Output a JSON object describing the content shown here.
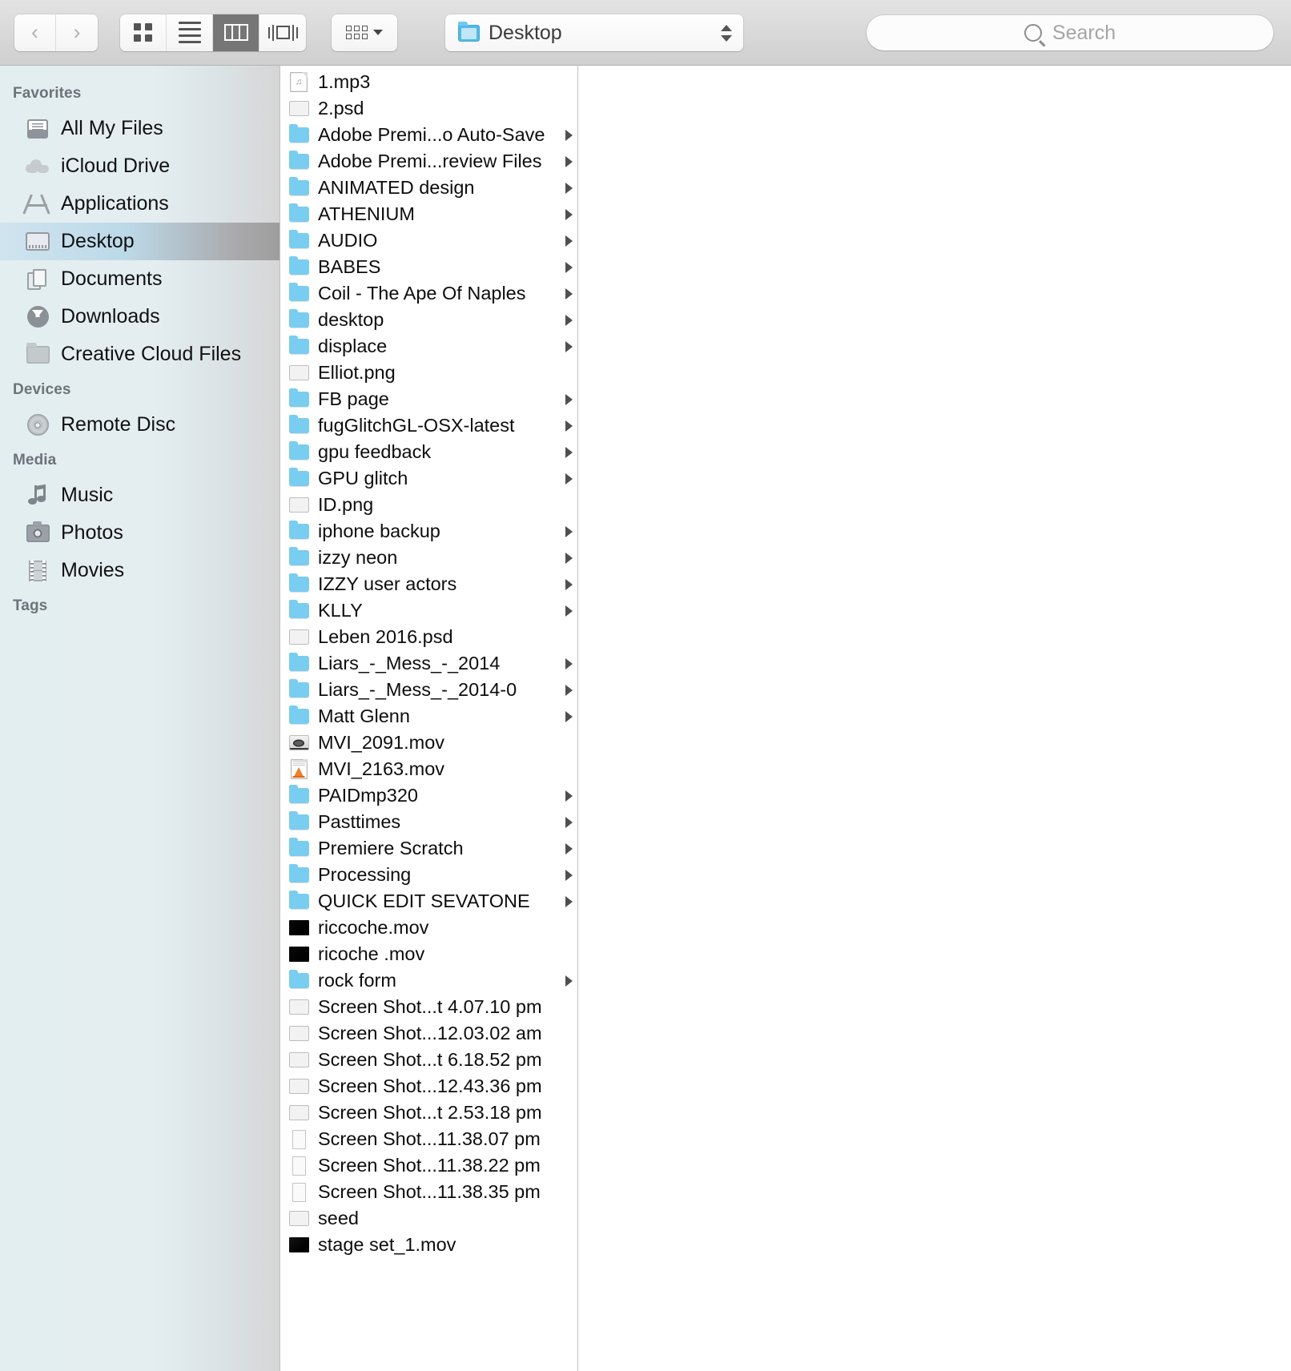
{
  "toolbar": {
    "back_icon": "chevron-left-icon",
    "forward_icon": "chevron-right-icon",
    "back_glyph": "‹",
    "forward_glyph": "›",
    "view_icon_grid": "icon-view-icon",
    "view_icon_list": "list-view-icon",
    "view_icon_column": "column-view-icon",
    "view_icon_coverflow": "coverflow-view-icon",
    "active_view": "column",
    "arrange_icon": "arrange-by-icon",
    "path_label": "Desktop",
    "path_icon": "blue-folder-icon",
    "stepper_icon": "up-down-stepper-icon",
    "search_placeholder": "Search",
    "search_value": "",
    "search_icon": "magnifier-icon"
  },
  "sidebar": {
    "sections": [
      {
        "title": "Favorites",
        "items": [
          {
            "label": "All My Files",
            "icon": "all-my-files-icon",
            "selected": false
          },
          {
            "label": "iCloud Drive",
            "icon": "icloud-drive-icon",
            "selected": false
          },
          {
            "label": "Applications",
            "icon": "applications-icon",
            "selected": false
          },
          {
            "label": "Desktop",
            "icon": "desktop-icon",
            "selected": true
          },
          {
            "label": "Documents",
            "icon": "documents-icon",
            "selected": false
          },
          {
            "label": "Downloads",
            "icon": "downloads-icon",
            "selected": false
          },
          {
            "label": "Creative Cloud Files",
            "icon": "creative-cloud-files-icon",
            "selected": false
          }
        ]
      },
      {
        "title": "Devices",
        "items": [
          {
            "label": "Remote Disc",
            "icon": "remote-disc-icon",
            "selected": false
          }
        ]
      },
      {
        "title": "Media",
        "items": [
          {
            "label": "Music",
            "icon": "music-icon",
            "selected": false
          },
          {
            "label": "Photos",
            "icon": "photos-icon",
            "selected": false
          },
          {
            "label": "Movies",
            "icon": "movies-icon",
            "selected": false
          }
        ]
      },
      {
        "title": "Tags",
        "items": []
      }
    ]
  },
  "file_column": {
    "path": "Desktop",
    "items": [
      {
        "name": "1.mp3",
        "icon": "audio-file-icon",
        "kind": "file",
        "expandable": false
      },
      {
        "name": "2.psd",
        "icon": "image-thumbnail-icon",
        "kind": "file",
        "expandable": false,
        "thumb": "#4a4a4a"
      },
      {
        "name": "Adobe Premi...o Auto-Save",
        "icon": "folder-icon",
        "kind": "folder",
        "expandable": true
      },
      {
        "name": "Adobe Premi...review Files",
        "icon": "folder-icon",
        "kind": "folder",
        "expandable": true
      },
      {
        "name": "ANIMATED design",
        "icon": "folder-icon",
        "kind": "folder",
        "expandable": true
      },
      {
        "name": "ATHENIUM",
        "icon": "folder-icon",
        "kind": "folder",
        "expandable": true
      },
      {
        "name": "AUDIO",
        "icon": "folder-icon",
        "kind": "folder",
        "expandable": true
      },
      {
        "name": "BABES",
        "icon": "folder-icon",
        "kind": "folder",
        "expandable": true
      },
      {
        "name": "Coil - The Ape Of Naples",
        "icon": "folder-icon",
        "kind": "folder",
        "expandable": true
      },
      {
        "name": "desktop",
        "icon": "folder-icon",
        "kind": "folder",
        "expandable": true
      },
      {
        "name": "displace",
        "icon": "folder-icon",
        "kind": "folder",
        "expandable": true
      },
      {
        "name": "Elliot.png",
        "icon": "image-thumbnail-icon",
        "kind": "file",
        "expandable": false,
        "thumb": "#3d3b3a"
      },
      {
        "name": "FB page",
        "icon": "folder-icon",
        "kind": "folder",
        "expandable": true
      },
      {
        "name": "fugGlitchGL-OSX-latest",
        "icon": "folder-icon",
        "kind": "folder",
        "expandable": true
      },
      {
        "name": "gpu feedback",
        "icon": "folder-icon",
        "kind": "folder",
        "expandable": true
      },
      {
        "name": "GPU glitch",
        "icon": "folder-icon",
        "kind": "folder",
        "expandable": true
      },
      {
        "name": "ID.png",
        "icon": "image-thumbnail-icon",
        "kind": "file",
        "expandable": false,
        "thumb": "#2b2b2b"
      },
      {
        "name": "iphone backup",
        "icon": "folder-icon",
        "kind": "folder",
        "expandable": true
      },
      {
        "name": "izzy neon",
        "icon": "folder-icon",
        "kind": "folder",
        "expandable": true
      },
      {
        "name": "IZZY user actors",
        "icon": "folder-icon",
        "kind": "folder",
        "expandable": true
      },
      {
        "name": "KLLY",
        "icon": "folder-icon",
        "kind": "folder",
        "expandable": true
      },
      {
        "name": "Leben 2016.psd",
        "icon": "image-thumbnail-icon",
        "kind": "file",
        "expandable": false,
        "thumb": "#1c1c1c"
      },
      {
        "name": "Liars_-_Mess_-_2014",
        "icon": "folder-icon",
        "kind": "folder",
        "expandable": true
      },
      {
        "name": "Liars_-_Mess_-_2014-0",
        "icon": "folder-icon",
        "kind": "folder",
        "expandable": true
      },
      {
        "name": "Matt Glenn",
        "icon": "folder-icon",
        "kind": "folder",
        "expandable": true
      },
      {
        "name": "MVI_2091.mov",
        "icon": "quicktime-movie-icon",
        "kind": "file",
        "expandable": false
      },
      {
        "name": "MVI_2163.mov",
        "icon": "vlc-movie-icon",
        "kind": "file",
        "expandable": false
      },
      {
        "name": "PAIDmp320",
        "icon": "folder-icon",
        "kind": "folder",
        "expandable": true
      },
      {
        "name": "Pasttimes",
        "icon": "folder-icon",
        "kind": "folder",
        "expandable": true
      },
      {
        "name": "Premiere Scratch",
        "icon": "folder-icon",
        "kind": "folder",
        "expandable": true
      },
      {
        "name": "Processing",
        "icon": "folder-icon",
        "kind": "folder",
        "expandable": true
      },
      {
        "name": "QUICK EDIT SEVATONE",
        "icon": "folder-icon",
        "kind": "folder",
        "expandable": true
      },
      {
        "name": "riccoche.mov",
        "icon": "movie-thumbnail-icon",
        "kind": "file",
        "expandable": false,
        "thumb": "#0a0a0a"
      },
      {
        "name": "ricoche .mov",
        "icon": "movie-thumbnail-icon",
        "kind": "file",
        "expandable": false,
        "thumb": "#0a0a0a"
      },
      {
        "name": "rock form",
        "icon": "folder-icon",
        "kind": "folder",
        "expandable": true
      },
      {
        "name": "Screen Shot...t 4.07.10 pm",
        "icon": "image-thumbnail-icon",
        "kind": "file",
        "expandable": false,
        "thumb": "#4f4a45"
      },
      {
        "name": "Screen Shot...12.03.02 am",
        "icon": "image-thumbnail-icon",
        "kind": "file",
        "expandable": false,
        "thumb": "#3a3a3c"
      },
      {
        "name": "Screen Shot...t 6.18.52 pm",
        "icon": "image-thumbnail-icon",
        "kind": "file",
        "expandable": false,
        "thumb": "#25c825"
      },
      {
        "name": "Screen Shot...12.43.36 pm",
        "icon": "image-thumbnail-icon",
        "kind": "file",
        "expandable": false,
        "thumb": "#8d8d8d"
      },
      {
        "name": "Screen Shot...t 2.53.18 pm",
        "icon": "image-thumbnail-icon",
        "kind": "file",
        "expandable": false,
        "thumb": "#5c5c5c"
      },
      {
        "name": "Screen Shot...11.38.07 pm",
        "icon": "portrait-thumbnail-icon",
        "kind": "file",
        "expandable": false,
        "thumb": "#9a7a52"
      },
      {
        "name": "Screen Shot...11.38.22 pm",
        "icon": "portrait-thumbnail-icon",
        "kind": "file",
        "expandable": false,
        "thumb": "#6d5336"
      },
      {
        "name": "Screen Shot...11.38.35 pm",
        "icon": "portrait-thumbnail-icon",
        "kind": "file",
        "expandable": false,
        "thumb": "#4a4f58"
      },
      {
        "name": "seed",
        "icon": "image-thumbnail-icon",
        "kind": "file",
        "expandable": false,
        "thumb": "#0b1b8c"
      },
      {
        "name": "stage set_1.mov",
        "icon": "movie-thumbnail-icon",
        "kind": "file",
        "expandable": false,
        "thumb": "#141414"
      }
    ]
  }
}
